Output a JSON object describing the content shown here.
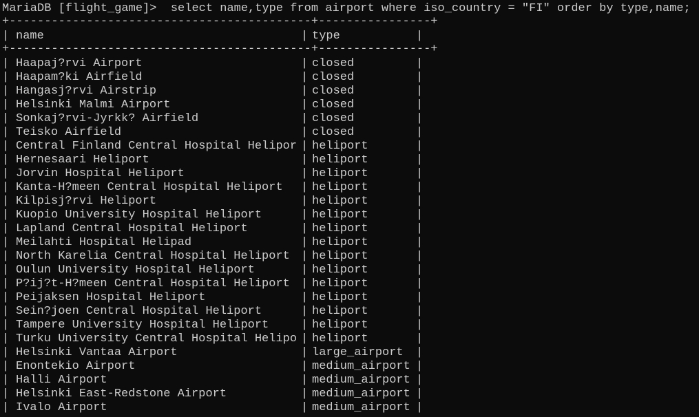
{
  "terminal": {
    "prompt": "MariaDB [flight_game]>",
    "command": "  select name,type from airport where iso_country = \"FI\" order by type,name;",
    "separator": "+-------------------------------------------+----------------+",
    "columns": {
      "name": "name",
      "type": "type"
    },
    "rows": [
      {
        "name": "Haapaj?rvi Airport",
        "type": "closed"
      },
      {
        "name": "Haapam?ki Airfield",
        "type": "closed"
      },
      {
        "name": "Hangasj?rvi Airstrip",
        "type": "closed"
      },
      {
        "name": "Helsinki Malmi Airport",
        "type": "closed"
      },
      {
        "name": "Sonkaj?rvi-Jyrkk? Airfield",
        "type": "closed"
      },
      {
        "name": "Teisko Airfield",
        "type": "closed"
      },
      {
        "name": "Central Finland Central Hospital Helipor",
        "type": "heliport"
      },
      {
        "name": "Hernesaari Heliport",
        "type": "heliport"
      },
      {
        "name": "Jorvin Hospital Heliport",
        "type": "heliport"
      },
      {
        "name": "Kanta-H?meen Central Hospital Heliport",
        "type": "heliport"
      },
      {
        "name": "Kilpisj?rvi Heliport",
        "type": "heliport"
      },
      {
        "name": "Kuopio University Hospital Heliport",
        "type": "heliport"
      },
      {
        "name": "Lapland Central Hospital Heliport",
        "type": "heliport"
      },
      {
        "name": "Meilahti Hospital Helipad",
        "type": "heliport"
      },
      {
        "name": "North Karelia Central Hospital Heliport",
        "type": "heliport"
      },
      {
        "name": "Oulun University Hospital Heliport",
        "type": "heliport"
      },
      {
        "name": "P?ij?t-H?meen Central Hospital Heliport",
        "type": "heliport"
      },
      {
        "name": "Peijaksen Hospital Heliport",
        "type": "heliport"
      },
      {
        "name": "Sein?joen Central Hospital Heliport",
        "type": "heliport"
      },
      {
        "name": "Tampere University Hospital Heliport",
        "type": "heliport"
      },
      {
        "name": "Turku University Central Hospital Helipo",
        "type": "heliport"
      },
      {
        "name": "Helsinki Vantaa Airport",
        "type": "large_airport"
      },
      {
        "name": "Enontekio Airport",
        "type": "medium_airport"
      },
      {
        "name": "Halli Airport",
        "type": "medium_airport"
      },
      {
        "name": "Helsinki East-Redstone Airport",
        "type": "medium_airport"
      },
      {
        "name": "Ivalo Airport",
        "type": "medium_airport"
      }
    ]
  }
}
